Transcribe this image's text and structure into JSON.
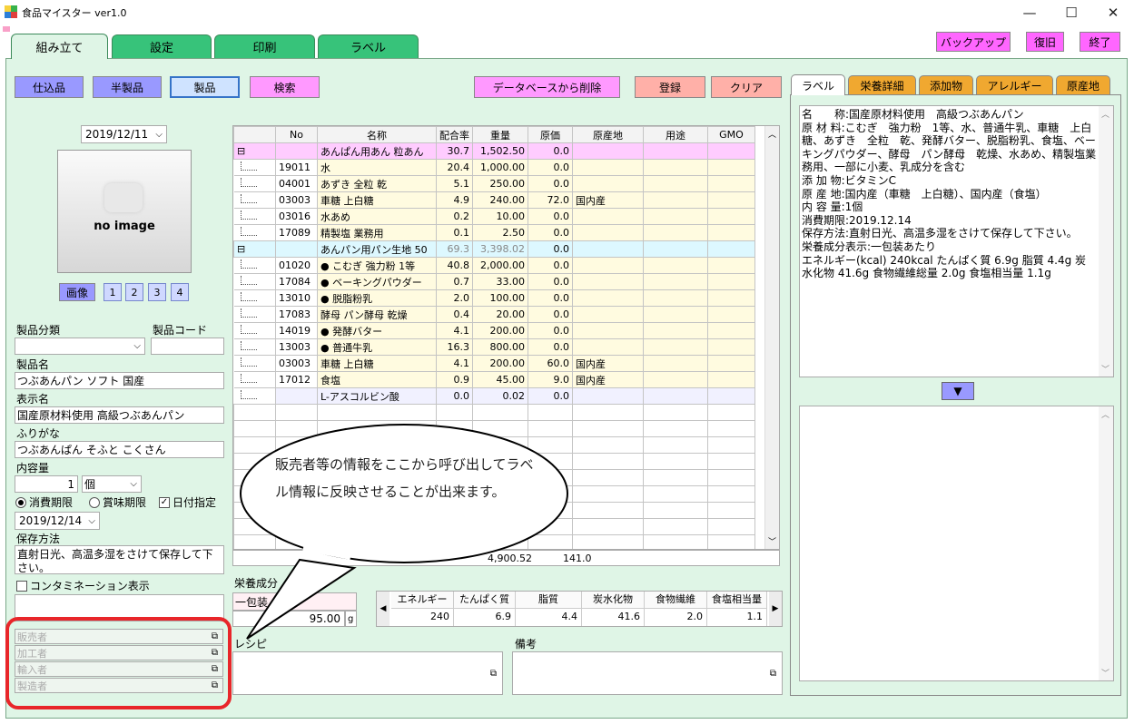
{
  "window": {
    "title": "食品マイスター ver1.0",
    "minimize": "—",
    "maximize": "☐",
    "close": "✕"
  },
  "tabs": [
    "組み立て",
    "設定",
    "印刷",
    "ラベル"
  ],
  "top_right_buttons": {
    "backup": "バックアップ",
    "restore": "復旧",
    "exit": "終了"
  },
  "toolbar": {
    "prep": "仕込品",
    "semi": "半製品",
    "product": "製品",
    "search": "検索",
    "delete_db": "データベースから削除",
    "register": "登録",
    "clear": "クリア"
  },
  "left": {
    "date": "2019/12/11",
    "no_image": "no image",
    "image_btn": "画像",
    "image_nums": [
      "1",
      "2",
      "3",
      "4"
    ],
    "category_label": "製品分類",
    "code_label": "製品コード",
    "category_value": "",
    "code_value": "",
    "name_label": "製品名",
    "name_value": "つぶあんパン ソフト 国産",
    "display_label": "表示名",
    "display_value": "国産原材料使用 高級つぶあんパン",
    "furigana_label": "ふりがな",
    "furigana_value": "つぶあんぱん そふと こくさん",
    "content_label": "内容量",
    "content_value": "1",
    "unit_value": "個",
    "expiry_consume": "消費期限",
    "expiry_best": "賞味期限",
    "date_spec": "日付指定",
    "expiry_date": "2019/12/14",
    "storage_label": "保存方法",
    "storage_value": "直射日光、高温多湿をさけて保存して下さい。",
    "contamination": "コンタミネーション表示",
    "contamination_value": "",
    "sellers": [
      "販売者",
      "加工者",
      "輸入者",
      "製造者"
    ]
  },
  "grid": {
    "headers": [
      "",
      "No",
      "名称",
      "配合率",
      "重量",
      "原価",
      "原産地",
      "用途",
      "GMO"
    ],
    "rows": [
      {
        "kind": "head",
        "tree": "⊟",
        "no": "",
        "name": "あんぱん用あん 粒あん",
        "ratio": "30.7",
        "weight": "1,502.50",
        "cost": "0.0",
        "origin": "",
        "use": "",
        "gmo": ""
      },
      {
        "kind": "item",
        "tree": "",
        "no": "19011",
        "name": "水",
        "ratio": "20.4",
        "weight": "1,000.00",
        "cost": "0.0",
        "origin": "",
        "use": "",
        "gmo": ""
      },
      {
        "kind": "item",
        "tree": "",
        "no": "04001",
        "name": "あずき 全粒 乾",
        "ratio": "5.1",
        "weight": "250.00",
        "cost": "0.0",
        "origin": "",
        "use": "",
        "gmo": ""
      },
      {
        "kind": "item",
        "tree": "",
        "no": "03003",
        "name": "車糖 上白糖",
        "ratio": "4.9",
        "weight": "240.00",
        "cost": "72.0",
        "origin": "国内産",
        "use": "",
        "gmo": ""
      },
      {
        "kind": "item",
        "tree": "",
        "no": "03016",
        "name": "水あめ",
        "ratio": "0.2",
        "weight": "10.00",
        "cost": "0.0",
        "origin": "",
        "use": "",
        "gmo": ""
      },
      {
        "kind": "item",
        "tree": "",
        "no": "17089",
        "name": "精製塩 業務用",
        "ratio": "0.1",
        "weight": "2.50",
        "cost": "0.0",
        "origin": "",
        "use": "",
        "gmo": ""
      },
      {
        "kind": "head2",
        "tree": "⊟",
        "no": "",
        "name": "あんパン用パン生地 50",
        "ratio": "69.3",
        "weight": "3,398.02",
        "cost": "0.0",
        "origin": "",
        "use": "",
        "gmo": ""
      },
      {
        "kind": "item",
        "tree": "",
        "no": "01020",
        "name": "● こむぎ 強力粉 1等",
        "ratio": "40.8",
        "weight": "2,000.00",
        "cost": "0.0",
        "origin": "",
        "use": "",
        "gmo": ""
      },
      {
        "kind": "item",
        "tree": "",
        "no": "17084",
        "name": "● ベーキングパウダー",
        "ratio": "0.7",
        "weight": "33.00",
        "cost": "0.0",
        "origin": "",
        "use": "",
        "gmo": ""
      },
      {
        "kind": "item",
        "tree": "",
        "no": "13010",
        "name": "● 脱脂粉乳",
        "ratio": "2.0",
        "weight": "100.00",
        "cost": "0.0",
        "origin": "",
        "use": "",
        "gmo": ""
      },
      {
        "kind": "item",
        "tree": "",
        "no": "17083",
        "name": "酵母 パン酵母 乾燥",
        "ratio": "0.4",
        "weight": "20.00",
        "cost": "0.0",
        "origin": "",
        "use": "",
        "gmo": ""
      },
      {
        "kind": "item",
        "tree": "",
        "no": "14019",
        "name": "● 発酵バター",
        "ratio": "4.1",
        "weight": "200.00",
        "cost": "0.0",
        "origin": "",
        "use": "",
        "gmo": ""
      },
      {
        "kind": "item",
        "tree": "",
        "no": "13003",
        "name": "● 普通牛乳",
        "ratio": "16.3",
        "weight": "800.00",
        "cost": "0.0",
        "origin": "",
        "use": "",
        "gmo": ""
      },
      {
        "kind": "item",
        "tree": "",
        "no": "03003",
        "name": "車糖 上白糖",
        "ratio": "4.1",
        "weight": "200.00",
        "cost": "60.0",
        "origin": "国内産",
        "use": "",
        "gmo": ""
      },
      {
        "kind": "item",
        "tree": "",
        "no": "17012",
        "name": "食塩",
        "ratio": "0.9",
        "weight": "45.00",
        "cost": "9.0",
        "origin": "国内産",
        "use": "",
        "gmo": ""
      },
      {
        "kind": "item2",
        "tree": "",
        "no": "",
        "name": "L-アスコルビン酸",
        "ratio": "0.0",
        "weight": "0.02",
        "cost": "0.0",
        "origin": "",
        "use": "",
        "gmo": ""
      }
    ],
    "totals": {
      "weight": "4,900.52",
      "cost": "141.0"
    }
  },
  "nutrition": {
    "label": "栄養成分",
    "per": "一包装",
    "amount": "95.00",
    "unit": "g",
    "headers": [
      "エネルギー",
      "たんぱく質",
      "脂質",
      "炭水化物",
      "食物繊維",
      "食塩相当量"
    ],
    "values": [
      "240",
      "6.9",
      "4.4",
      "41.6",
      "2.0",
      "1.1"
    ]
  },
  "recipe_label": "レシピ",
  "note_label": "備考",
  "right_tabs": [
    "ラベル",
    "栄養詳細",
    "添加物",
    "アレルギー",
    "原産地"
  ],
  "label_text": "名　　称:国産原材料使用　高級つぶあんパン\n原 材 料:こむぎ　強力粉　1等、水、普通牛乳、車糖　上白糖、あずき　全粒　乾、発酵バター、脱脂粉乳、食塩、ベーキングパウダー、酵母　パン酵母　乾燥、水あめ、精製塩業務用、一部に小麦、乳成分を含む\n添 加 物:ビタミンC\n原 産 地:国内産（車糖　上白糖）、国内産（食塩）\n内 容 量:1個\n消費期限:2019.12.14\n保存方法:直射日光、高温多湿をさけて保存して下さい。\n栄養成分表示:一包装あたり\nエネルギー(kcal) 240kcal たんぱく質 6.9g 脂質 4.4g 炭水化物 41.6g 食物繊維総量 2.0g 食塩相当量 1.1g",
  "callout_text": "販売者等の情報をここから呼び出してラベル情報に反映させることが出来ます。",
  "colors": {
    "panel": "#dff5e6",
    "tab": "#37c37a",
    "highlight": "#e8262a"
  }
}
